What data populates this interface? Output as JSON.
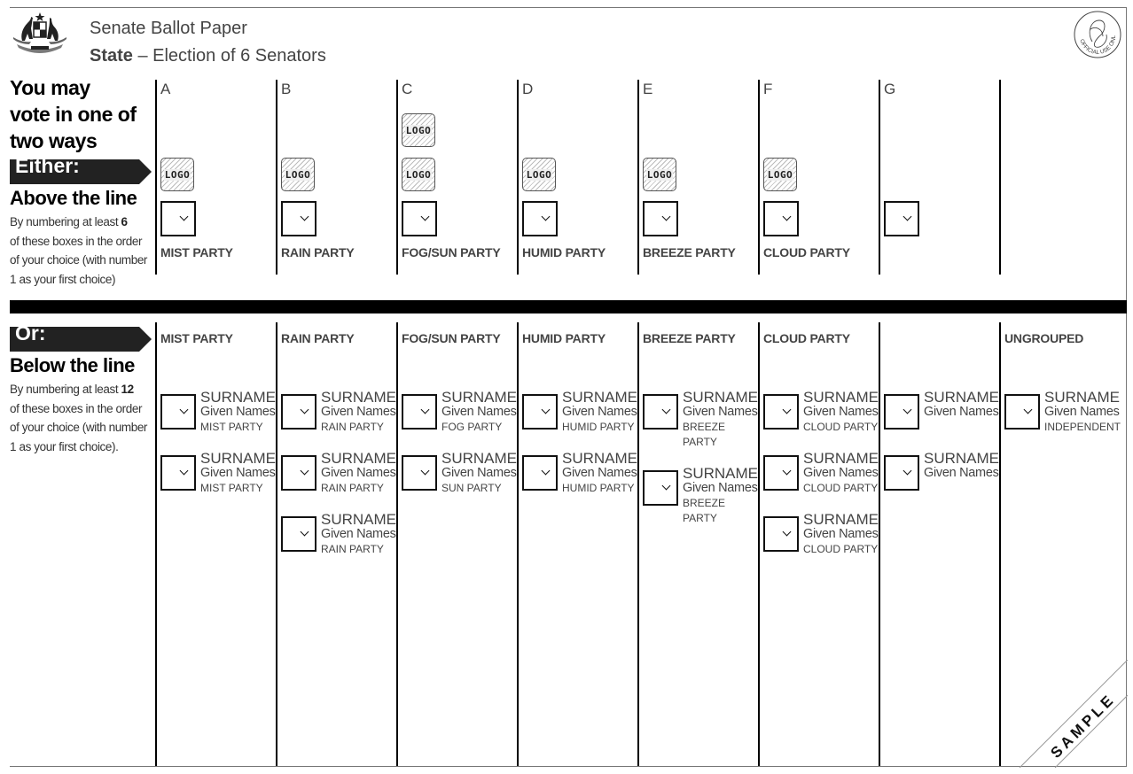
{
  "header": {
    "title": "Senate Ballot Paper",
    "state_bold": "State",
    "subtitle": " – Election of 6 Senators",
    "official_stamp": "OFFICIAL USE ONLY",
    "crest_icon": "coat-of-arms-icon"
  },
  "intro": {
    "line1": "You may",
    "line2": "vote in one of",
    "line3": "two ways"
  },
  "above": {
    "arrow_label": "Either:",
    "heading": "Above the line",
    "instr_pre": "By numbering at least ",
    "instr_num": "6",
    "instr_l2": "of these boxes in the order",
    "instr_l3": "of your choice (with number",
    "instr_l4": "1 as your first choice)",
    "columns": [
      {
        "letter": "A",
        "party": "MIST PARTY",
        "logos": 1
      },
      {
        "letter": "B",
        "party": "RAIN PARTY",
        "logos": 1
      },
      {
        "letter": "C",
        "party": "FOG/SUN PARTY",
        "logos": 2
      },
      {
        "letter": "D",
        "party": "HUMID PARTY",
        "logos": 1
      },
      {
        "letter": "E",
        "party": "BREEZE PARTY",
        "logos": 1
      },
      {
        "letter": "F",
        "party": "CLOUD PARTY",
        "logos": 1
      },
      {
        "letter": "G",
        "party": "",
        "logos": 0
      }
    ],
    "logo_text": "LOGO"
  },
  "below": {
    "arrow_label": "Or:",
    "heading": "Below the line",
    "instr_pre": "By numbering at least ",
    "instr_num": "12",
    "instr_l2": "of these boxes in the order",
    "instr_l3": "of your choice (with number",
    "instr_l4": "1 as your first choice).",
    "columns": [
      {
        "party": "MIST PARTY",
        "candidates": [
          {
            "surname": "SURNAME",
            "given": "Given Names",
            "party": "MIST PARTY"
          },
          {
            "surname": "SURNAME",
            "given": "Given Names",
            "party": "MIST PARTY"
          }
        ]
      },
      {
        "party": "RAIN PARTY",
        "candidates": [
          {
            "surname": "SURNAME",
            "given": "Given Names",
            "party": "RAIN PARTY"
          },
          {
            "surname": "SURNAME",
            "given": "Given Names",
            "party": "RAIN PARTY"
          },
          {
            "surname": "SURNAME",
            "given": "Given Names",
            "party": "RAIN PARTY"
          }
        ]
      },
      {
        "party": "FOG/SUN PARTY",
        "candidates": [
          {
            "surname": "SURNAME",
            "given": "Given Names",
            "party": "FOG PARTY"
          },
          {
            "surname": "SURNAME",
            "given": "Given Names",
            "party": "SUN PARTY"
          }
        ]
      },
      {
        "party": "HUMID PARTY",
        "candidates": [
          {
            "surname": "SURNAME",
            "given": "Given Names",
            "party": "HUMID PARTY"
          },
          {
            "surname": "SURNAME",
            "given": "Given Names",
            "party": "HUMID PARTY"
          }
        ]
      },
      {
        "party": "BREEZE PARTY",
        "candidates": [
          {
            "surname": "SURNAME",
            "given": "Given Names",
            "party": "BREEZE PARTY"
          },
          {
            "surname": "SURNAME",
            "given": "Given Names",
            "party": "BREEZE PARTY"
          }
        ]
      },
      {
        "party": "CLOUD PARTY",
        "candidates": [
          {
            "surname": "SURNAME",
            "given": "Given Names",
            "party": "CLOUD PARTY"
          },
          {
            "surname": "SURNAME",
            "given": "Given Names",
            "party": "CLOUD PARTY"
          },
          {
            "surname": "SURNAME",
            "given": "Given Names",
            "party": "CLOUD PARTY"
          }
        ]
      },
      {
        "party": "",
        "candidates": [
          {
            "surname": "SURNAME",
            "given": "Given Names",
            "party": ""
          },
          {
            "surname": "SURNAME",
            "given": "Given Names",
            "party": ""
          }
        ]
      },
      {
        "party": "UNGROUPED",
        "candidates": [
          {
            "surname": "SURNAME",
            "given": "Given Names",
            "party": "INDEPENDENT"
          }
        ]
      }
    ]
  },
  "watermark": "SAMPLE"
}
